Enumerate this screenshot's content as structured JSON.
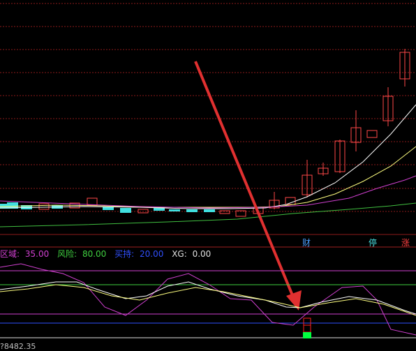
{
  "badges": [
    {
      "text": "财",
      "color": "#4a9fff"
    },
    {
      "text": "停",
      "color": "#4adfe0"
    },
    {
      "text": "涨",
      "color": "#ff4040"
    }
  ],
  "indicator": {
    "items": [
      {
        "label": "区域:",
        "value": "35.00",
        "color": "#d040d0"
      },
      {
        "label": "风险:",
        "value": "80.00",
        "color": "#40d040"
      },
      {
        "label": "买持:",
        "value": "20.00",
        "color": "#3050ff"
      },
      {
        "label": "XG:",
        "value": "0.00",
        "color": "#e0e0e0"
      }
    ]
  },
  "bottom_text": "?8482.35",
  "colors": {
    "up": "#ff4848",
    "down": "#40e0e0",
    "grid": "#8b1a1a",
    "ma_white": "#ffffff",
    "ma_yellow": "#ffff80",
    "ma_magenta": "#d040d0",
    "ma_green": "#40c040",
    "arrow": "#e03030",
    "signal_box": "#ff2020",
    "signal_fill": "#00ff40"
  }
}
